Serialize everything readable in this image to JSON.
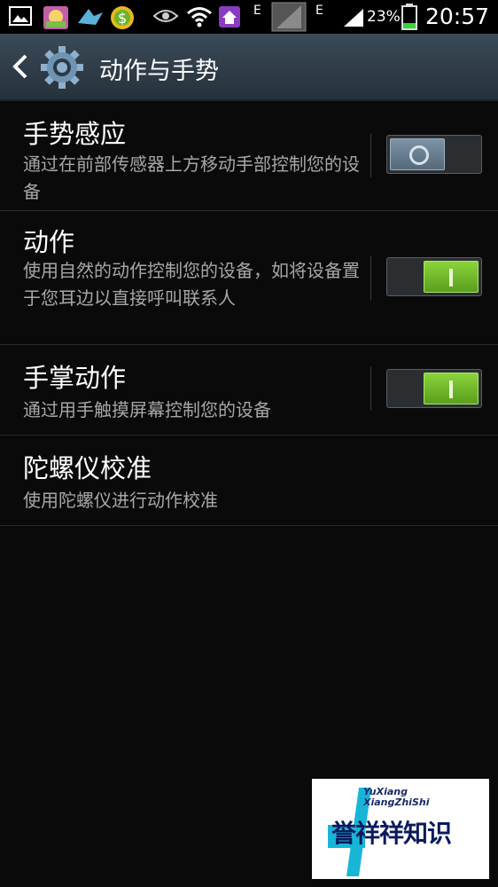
{
  "status_bar": {
    "signal_letter_1": "E",
    "signal_letter_2": "E",
    "battery_percent": "23%",
    "time": "20:57",
    "icons": [
      "gallery-icon",
      "photo-app-icon",
      "notification-bird-icon",
      "money-app-icon",
      "eye-icon",
      "wifi-icon",
      "home-app-icon",
      "signal-icon",
      "battery-icon"
    ]
  },
  "action_bar": {
    "title": "动作与手势"
  },
  "settings": [
    {
      "title": "手势感应",
      "subtitle": "通过在前部传感器上方移动手部控制您的设备",
      "toggle": "off"
    },
    {
      "title": "动作",
      "subtitle": "使用自然的动作控制您的设备，如将设备置于您耳边以直接呼叫联系人",
      "toggle": "on"
    },
    {
      "title": "手掌动作",
      "subtitle": "通过用手触摸屏幕控制您的设备",
      "toggle": "on"
    },
    {
      "title": "陀螺仪校准",
      "subtitle": "使用陀螺仪进行动作校准"
    }
  ],
  "watermark": {
    "line1": "YuXiang",
    "line2": "XiangZhiShi",
    "brand": "誉祥祥知识"
  },
  "colors": {
    "background": "#0a0a0a",
    "action_bar": "#2f3c48",
    "toggle_on": "#7cc832",
    "toggle_off": "#6a8092",
    "watermark_accent": "#17b6d6"
  }
}
